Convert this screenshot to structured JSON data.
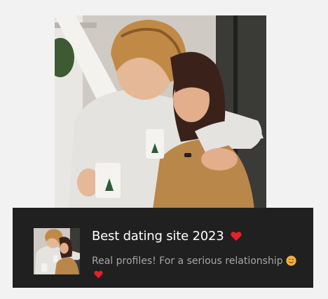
{
  "post": {
    "image_alt": "couple-photo",
    "headline": "Best dating site 2023",
    "subtitle": "Real profiles! For a serious relationship",
    "heart_color": "#e6212a",
    "smiley_color": "#f4b23c",
    "card_background": "#202020",
    "page_background": "#f2f2f2"
  }
}
